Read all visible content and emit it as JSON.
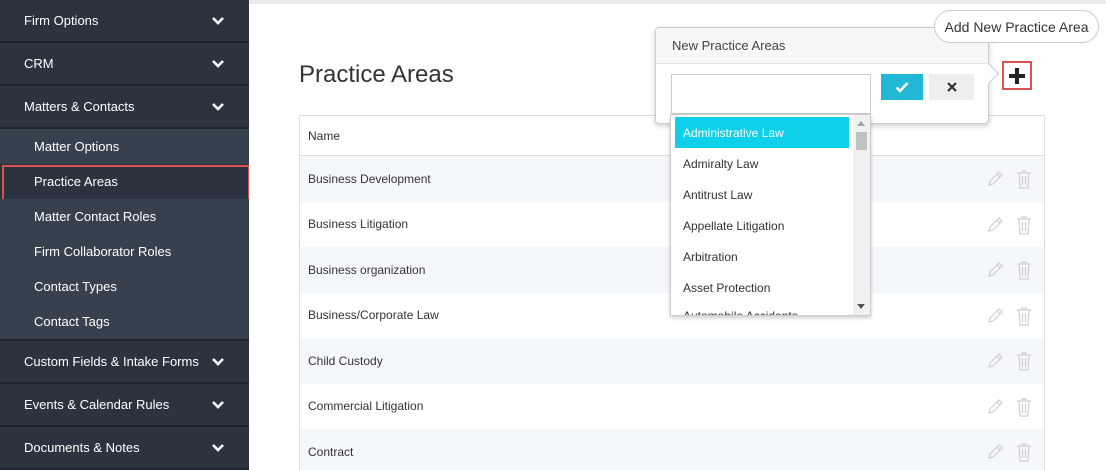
{
  "sidebar": {
    "top_sections": [
      {
        "label": "Firm Options"
      },
      {
        "label": "CRM"
      },
      {
        "label": "Matters & Contacts"
      }
    ],
    "sub_items": [
      {
        "label": "Matter Options"
      },
      {
        "label": "Practice Areas"
      },
      {
        "label": "Matter Contact Roles"
      },
      {
        "label": "Firm Collaborator Roles"
      },
      {
        "label": "Contact Types"
      },
      {
        "label": "Contact Tags"
      }
    ],
    "bottom_sections": [
      {
        "label": "Custom Fields & Intake Forms"
      },
      {
        "label": "Events & Calendar Rules"
      },
      {
        "label": "Documents & Notes"
      }
    ],
    "active_item": "Practice Areas"
  },
  "main": {
    "title": "Practice Areas",
    "table": {
      "header": "Name",
      "rows": [
        {
          "name": "Business Development"
        },
        {
          "name": "Business Litigation"
        },
        {
          "name": "Business organization"
        },
        {
          "name": "Business/Corporate Law"
        },
        {
          "name": "Child Custody"
        },
        {
          "name": "Commercial Litigation"
        },
        {
          "name": "Contract"
        }
      ]
    }
  },
  "popup": {
    "title": "New Practice Areas",
    "input_value": "",
    "dropdown_options": [
      {
        "label": "Administrative Law"
      },
      {
        "label": "Admiralty Law"
      },
      {
        "label": "Antitrust Law"
      },
      {
        "label": "Appellate Litigation"
      },
      {
        "label": "Arbitration"
      },
      {
        "label": "Asset Protection"
      },
      {
        "label": "Automobile Accidents"
      }
    ],
    "selected_option": "Administrative Law"
  },
  "tooltip": {
    "text": "Add New Practice Area"
  },
  "icons": {
    "add": "plus-icon",
    "confirm": "check-icon",
    "cancel": "close-icon",
    "edit": "pencil-icon",
    "delete": "trash-icon",
    "expand": "chevron-down-icon"
  },
  "colors": {
    "sidebar_bg": "#36414d",
    "sidebar_section_bg": "#2b343e",
    "accent": "#23b7d6",
    "selected_option": "#0fd0ea",
    "highlight_border": "#d9534f"
  }
}
